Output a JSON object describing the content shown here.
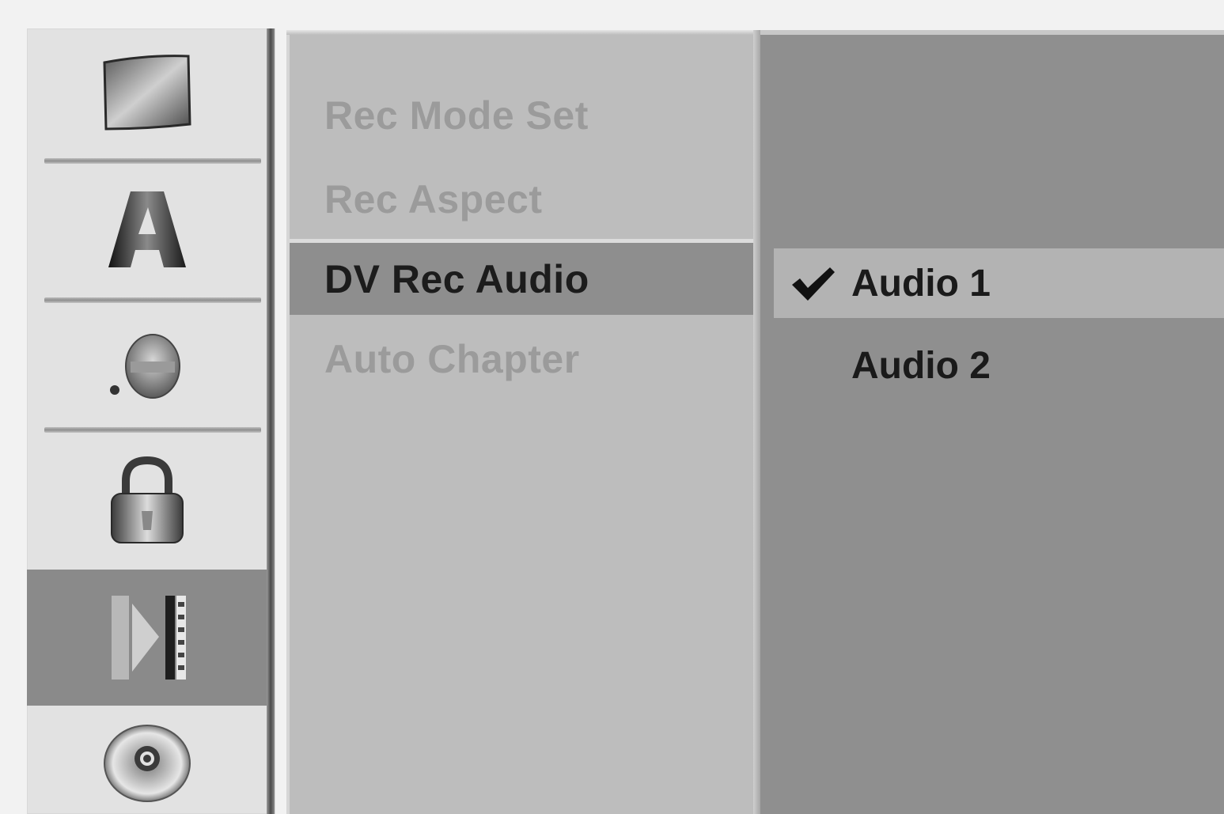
{
  "categories": [
    {
      "id": "general",
      "icon": "tv-icon",
      "selected": false
    },
    {
      "id": "language",
      "icon": "letter-a-icon",
      "selected": false
    },
    {
      "id": "audio",
      "icon": "speaker-icon",
      "selected": false
    },
    {
      "id": "lock",
      "icon": "padlock-icon",
      "selected": false
    },
    {
      "id": "recording",
      "icon": "record-icon",
      "selected": true
    },
    {
      "id": "disc",
      "icon": "disc-icon",
      "selected": false
    }
  ],
  "menu": {
    "items": [
      {
        "label": "Rec Mode Set",
        "active": false
      },
      {
        "label": "Rec Aspect",
        "active": false
      },
      {
        "label": "DV Rec Audio",
        "active": true
      },
      {
        "label": "Auto Chapter",
        "active": false
      }
    ]
  },
  "options": {
    "items": [
      {
        "label": "Audio 1",
        "checked": true
      },
      {
        "label": "Audio 2",
        "checked": false
      }
    ],
    "check_glyph": "✔"
  },
  "colors": {
    "selected_background": "#8a8a8a",
    "dimmed_text": "#9b9b9b",
    "active_text": "#1c1c1c"
  }
}
